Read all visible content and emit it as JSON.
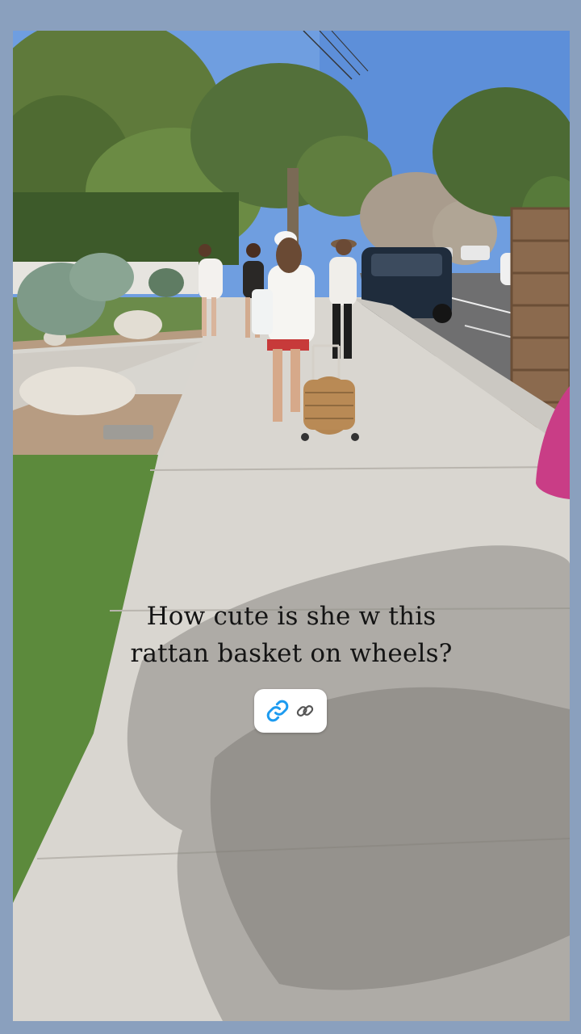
{
  "story": {
    "caption_lines": [
      "How cute is she w this",
      "rattan basket on wheels?"
    ],
    "link_sticker": {
      "icons": [
        "link-icon",
        "chain-link-icon"
      ],
      "accent_color": "#1d9bf0"
    }
  }
}
